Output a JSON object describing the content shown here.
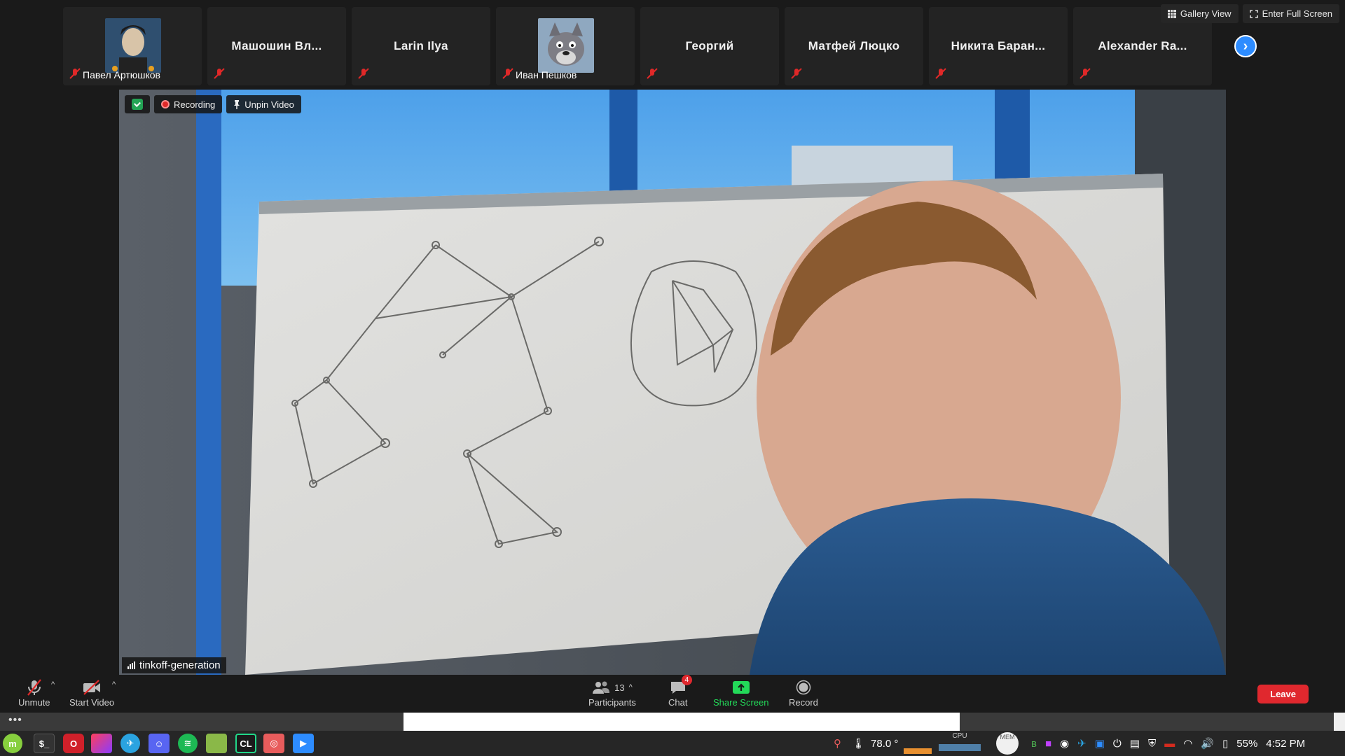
{
  "window": {
    "gallery_view_label": "Gallery View",
    "full_screen_label": "Enter Full Screen"
  },
  "participants_strip": [
    {
      "name": "Павел Артюшков",
      "has_video": true
    },
    {
      "name": "Машошин Вл...",
      "has_video": false
    },
    {
      "name": "Larin Ilya",
      "has_video": false
    },
    {
      "name": "Иван Пешков",
      "has_video": true
    },
    {
      "name": "Георгий",
      "has_video": false
    },
    {
      "name": "Матфей Люцко",
      "has_video": false
    },
    {
      "name": "Никита Баран...",
      "has_video": false
    },
    {
      "name": "Alexander Ra...",
      "has_video": false
    }
  ],
  "main_video": {
    "recording_label": "Recording",
    "unpin_label": "Unpin Video",
    "speaker_name": "tinkoff-generation"
  },
  "toolbar": {
    "unmute_label": "Unmute",
    "start_video_label": "Start Video",
    "participants_label": "Participants",
    "participants_count": "13",
    "chat_label": "Chat",
    "chat_badge": "4",
    "share_label": "Share Screen",
    "record_label": "Record",
    "leave_label": "Leave"
  },
  "lower_strip": {
    "dots": "•••"
  },
  "taskbar": {
    "apps": [
      "linux-mint-menu",
      "terminal",
      "opera",
      "app-tile",
      "telegram",
      "discord",
      "spotify",
      "files",
      "clion",
      "screenshot-app",
      "zoom"
    ],
    "temperature": "78.0 °",
    "cpu_label": "CPU",
    "mem_label": "MEM",
    "battery": "55%",
    "time": "4:52 PM"
  },
  "colors": {
    "zoom_blue": "#2d8cff",
    "leave_red": "#e0282e",
    "share_green": "#23d959"
  }
}
